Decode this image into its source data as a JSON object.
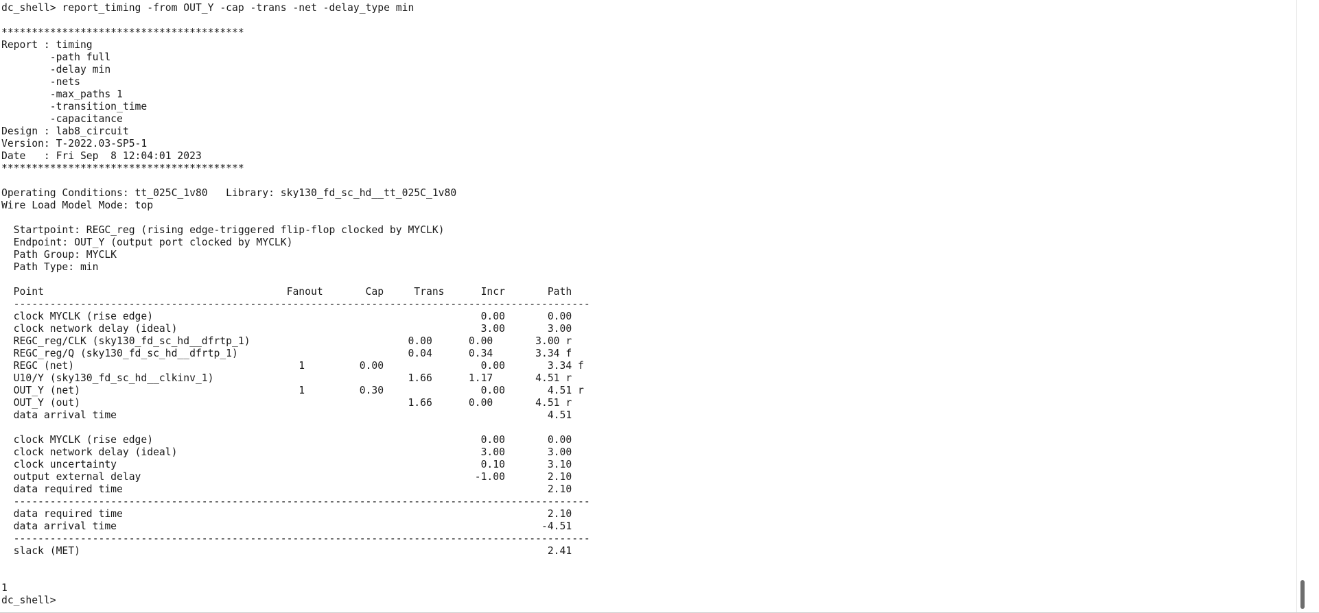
{
  "terminal": {
    "lines": [
      "dc_shell> report_timing -from OUT_Y -cap -trans -net -delay_type min",
      "",
      "****************************************",
      "Report : timing",
      "        -path full",
      "        -delay min",
      "        -nets",
      "        -max_paths 1",
      "        -transition_time",
      "        -capacitance",
      "Design : lab8_circuit",
      "Version: T-2022.03-SP5-1",
      "Date   : Fri Sep  8 12:04:01 2023",
      "****************************************",
      "",
      "Operating Conditions: tt_025C_1v80   Library: sky130_fd_sc_hd__tt_025C_1v80",
      "Wire Load Model Mode: top",
      "",
      "  Startpoint: REGC_reg (rising edge-triggered flip-flop clocked by MYCLK)",
      "  Endpoint: OUT_Y (output port clocked by MYCLK)",
      "  Path Group: MYCLK",
      "  Path Type: min",
      "",
      "  Point                                        Fanout       Cap     Trans      Incr       Path",
      "  -----------------------------------------------------------------------------------------------",
      "  clock MYCLK (rise edge)                                                      0.00       0.00",
      "  clock network delay (ideal)                                                  3.00       3.00",
      "  REGC_reg/CLK (sky130_fd_sc_hd__dfrtp_1)                          0.00      0.00       3.00 r",
      "  REGC_reg/Q (sky130_fd_sc_hd__dfrtp_1)                            0.04      0.34       3.34 f",
      "  REGC (net)                                     1         0.00                0.00       3.34 f",
      "  U10/Y (sky130_fd_sc_hd__clkinv_1)                                1.66      1.17       4.51 r",
      "  OUT_Y (net)                                    1         0.30                0.00       4.51 r",
      "  OUT_Y (out)                                                      1.66      0.00       4.51 r",
      "  data arrival time                                                                       4.51",
      "",
      "  clock MYCLK (rise edge)                                                      0.00       0.00",
      "  clock network delay (ideal)                                                  3.00       3.00",
      "  clock uncertainty                                                            0.10       3.10",
      "  output external delay                                                       -1.00       2.10",
      "  data required time                                                                      2.10",
      "  -----------------------------------------------------------------------------------------------",
      "  data required time                                                                      2.10",
      "  data arrival time                                                                      -4.51",
      "  -----------------------------------------------------------------------------------------------",
      "  slack (MET)                                                                             2.41",
      "",
      "",
      "1",
      "dc_shell> "
    ]
  },
  "scrollbar": {
    "position_fraction": 1.0
  }
}
